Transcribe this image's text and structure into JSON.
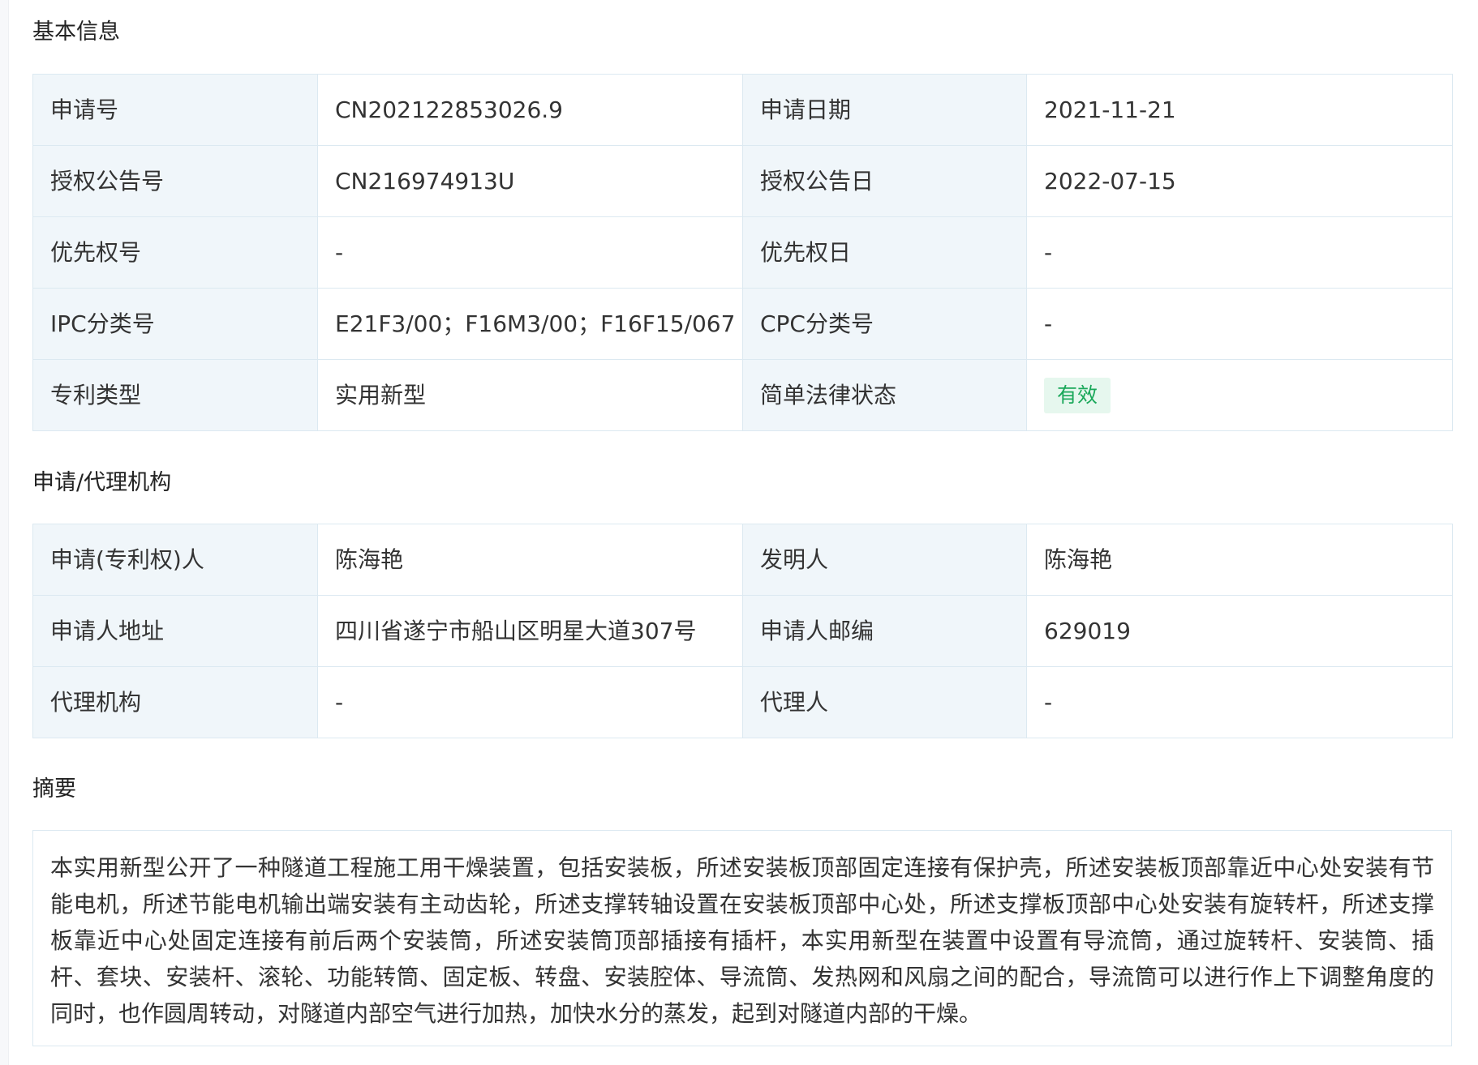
{
  "sections": {
    "basic": {
      "title": "基本信息",
      "rows": [
        [
          {
            "label": "申请号",
            "value": "CN202122853026.9"
          },
          {
            "label": "申请日期",
            "value": "2021-11-21"
          }
        ],
        [
          {
            "label": "授权公告号",
            "value": "CN216974913U"
          },
          {
            "label": "授权公告日",
            "value": "2022-07-15"
          }
        ],
        [
          {
            "label": "优先权号",
            "value": "-"
          },
          {
            "label": "优先权日",
            "value": "-"
          }
        ],
        [
          {
            "label": "IPC分类号",
            "value": "E21F3/00；F16M3/00；F16F15/067"
          },
          {
            "label": "CPC分类号",
            "value": "-"
          }
        ],
        [
          {
            "label": "专利类型",
            "value": "实用新型"
          },
          {
            "label": "简单法律状态",
            "value": "有效"
          }
        ]
      ]
    },
    "agency": {
      "title": "申请/代理机构",
      "rows": [
        [
          {
            "label": "申请(专利权)人",
            "value": "陈海艳"
          },
          {
            "label": "发明人",
            "value": "陈海艳"
          }
        ],
        [
          {
            "label": "申请人地址",
            "value": "四川省遂宁市船山区明星大道307号"
          },
          {
            "label": "申请人邮编",
            "value": "629019"
          }
        ],
        [
          {
            "label": "代理机构",
            "value": "-"
          },
          {
            "label": "代理人",
            "value": "-"
          }
        ]
      ]
    },
    "abstract": {
      "title": "摘要",
      "text": "本实用新型公开了一种隧道工程施工用干燥装置，包括安装板，所述安装板顶部固定连接有保护壳，所述安装板顶部靠近中心处安装有节能电机，所述节能电机输出端安装有主动齿轮，所述支撑转轴设置在安装板顶部中心处，所述支撑板顶部中心处安装有旋转杆，所述支撑板靠近中心处固定连接有前后两个安装筒，所述安装筒顶部插接有插杆，本实用新型在装置中设置有导流筒，通过旋转杆、安装筒、插杆、套块、安装杆、滚轮、功能转筒、固定板、转盘、安装腔体、导流筒、发热网和风扇之间的配合，导流筒可以进行作上下调整角度的同时，也作圆周转动，对隧道内部空气进行加热，加快水分的蒸发，起到对隧道内部的干燥。"
    }
  },
  "colors": {
    "label_bg": "#f0f6fa",
    "border": "#dce9f1",
    "status_valid_bg": "#e6f7ee",
    "status_valid_text": "#1aa85a"
  }
}
